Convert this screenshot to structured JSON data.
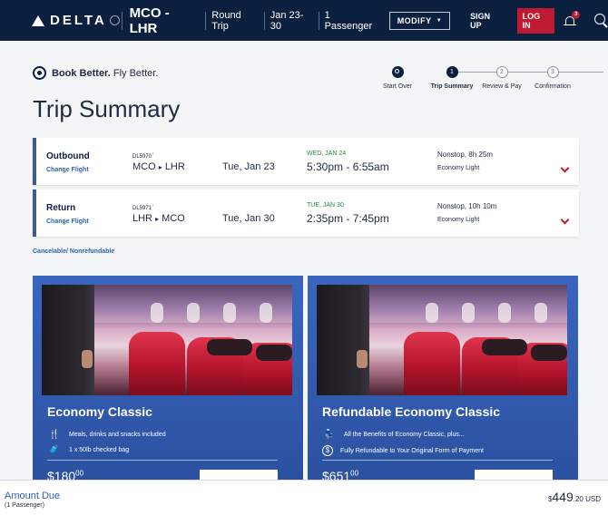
{
  "header": {
    "brand": "DELTA",
    "route": "MCO - LHR",
    "trip_type": "Round Trip",
    "dates": "Jan 23-30",
    "passengers": "1 Passenger",
    "modify_label": "MODIFY",
    "signup_label": "SIGN UP",
    "login_label": "LOG IN",
    "notification_count": "3"
  },
  "book_better": {
    "bold": "Book Better.",
    "rest": " Fly Better."
  },
  "stepper": [
    {
      "label": "Start Over",
      "num": "",
      "state": "done"
    },
    {
      "label": "Trip Summary",
      "num": "1",
      "state": "current"
    },
    {
      "label": "Review & Pay",
      "num": "2",
      "state": "todo"
    },
    {
      "label": "Confirmation",
      "num": "3",
      "state": "todo"
    }
  ],
  "page_title": "Trip Summary",
  "flights": [
    {
      "direction": "Outbound",
      "change_label": "Change Flight",
      "flight_no": "DL5970",
      "from": "MCO",
      "to": "LHR",
      "date": "Tue, Jan 23",
      "arrival_date": "WED, JAN 24",
      "times": "5:30pm - 6:55am",
      "stops": "Nonstop, 8h 25m",
      "cabin": "Economy Light"
    },
    {
      "direction": "Return",
      "change_label": "Change Flight",
      "flight_no": "DL5971",
      "from": "LHR",
      "to": "MCO",
      "date": "Tue, Jan 30",
      "arrival_date": "TUE, JAN 30",
      "times": "2:35pm - 7:45pm",
      "stops": "Nonstop, 10h 10m",
      "cabin": "Economy Light"
    }
  ],
  "policy": "Cancelable/ Nonrefundable",
  "fares": [
    {
      "name": "Economy Classic",
      "features": [
        {
          "icon": "meal-icon",
          "glyph": "🍴",
          "text": "Meals, drinks and snacks included"
        },
        {
          "icon": "bag-icon",
          "glyph": "🧳",
          "text": "1 x 50lb checked bag"
        }
      ],
      "price_dollars": "$180",
      "price_cents": "00"
    },
    {
      "name": "Refundable Economy Classic",
      "features": [
        {
          "icon": "seat-icon",
          "glyph": "💺",
          "text": "All the Benefits of Economy Classic, plus..."
        },
        {
          "icon": "dollar-icon",
          "glyph": "$",
          "text": "Fully Refundable to Your Original Form of Payment"
        }
      ],
      "price_dollars": "$651",
      "price_cents": "00"
    }
  ],
  "footer": {
    "label": "Amount Due",
    "sub": "(1 Passenger)",
    "currency_symbol": "$",
    "amount_dollars": "449",
    "amount_cents": ".20",
    "currency": "USD"
  },
  "colors": {
    "navy": "#0b1f3f",
    "red": "#c01933",
    "link": "#2c63b0",
    "card": "#2a4f9e"
  }
}
